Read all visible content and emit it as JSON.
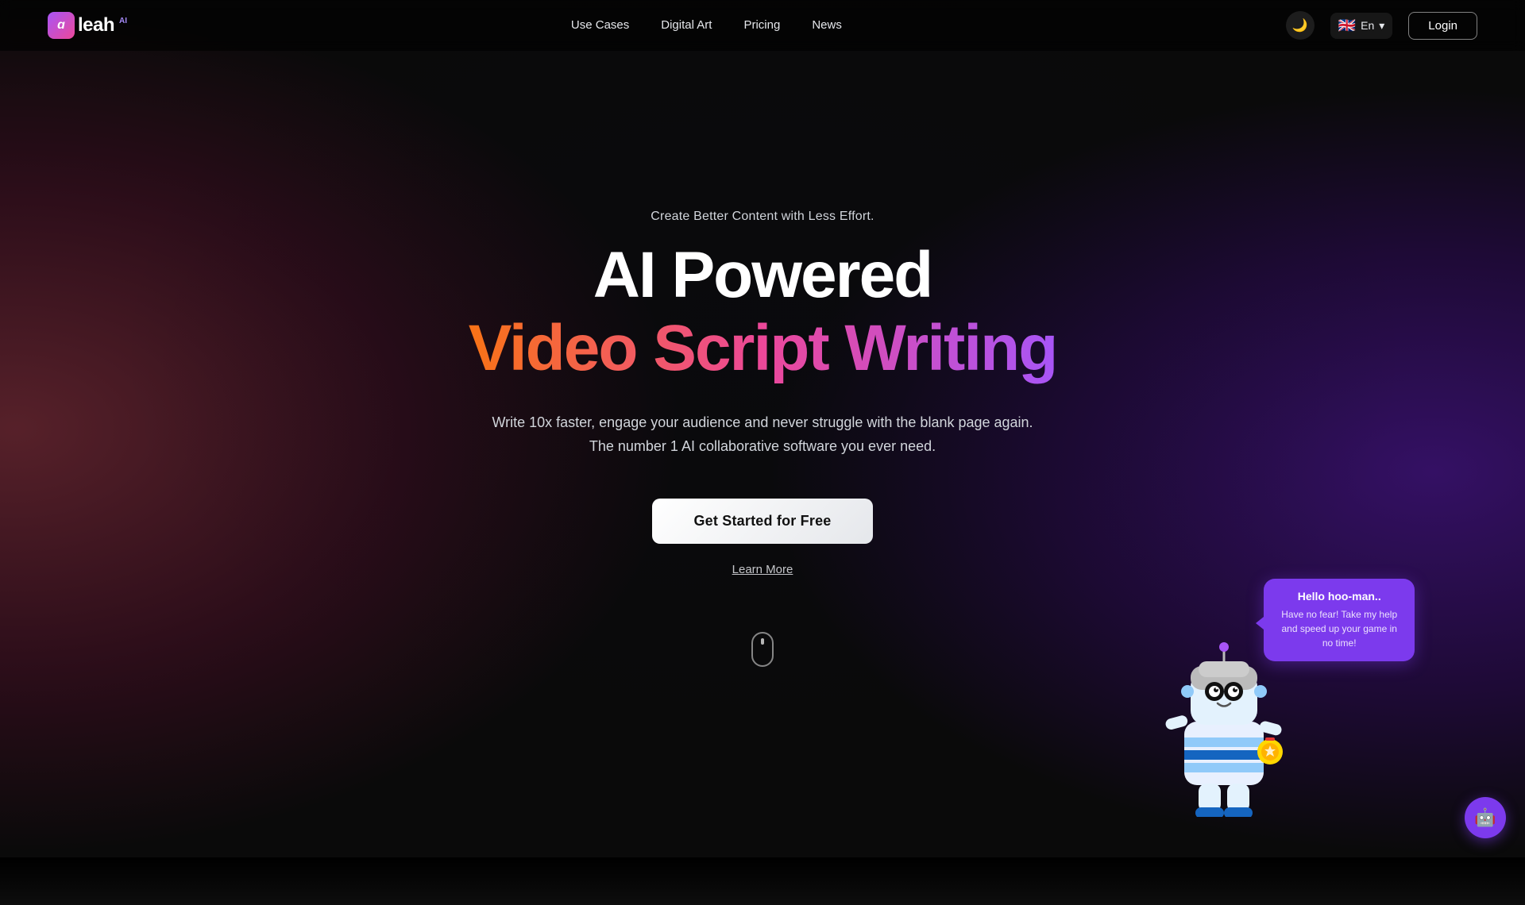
{
  "brand": {
    "name": "leah",
    "ai_badge": "AI",
    "logo_letter": "a"
  },
  "nav": {
    "links": [
      {
        "label": "Use Cases",
        "href": "#"
      },
      {
        "label": "Digital Art",
        "href": "#"
      },
      {
        "label": "Pricing",
        "href": "#"
      },
      {
        "label": "News",
        "href": "#"
      }
    ],
    "theme_icon": "🌙",
    "lang_flag": "🇬🇧",
    "lang_code": "En",
    "login_label": "Login"
  },
  "hero": {
    "subtitle": "Create Better Content with Less Effort.",
    "title_white": "AI Powered",
    "title_gradient": "Video Script Writing",
    "description_line1": "Write 10x faster, engage your audience and never struggle with the blank page again.",
    "description_line2": "The number 1 AI collaborative software you ever need.",
    "cta_label": "Get Started for Free",
    "learn_more_label": "Learn More"
  },
  "robot": {
    "chat_title": "Hello hoo-man..",
    "chat_text": "Have no fear! Take my help and speed up your game in no time!"
  },
  "chat_widget": {
    "icon": "🤖"
  }
}
